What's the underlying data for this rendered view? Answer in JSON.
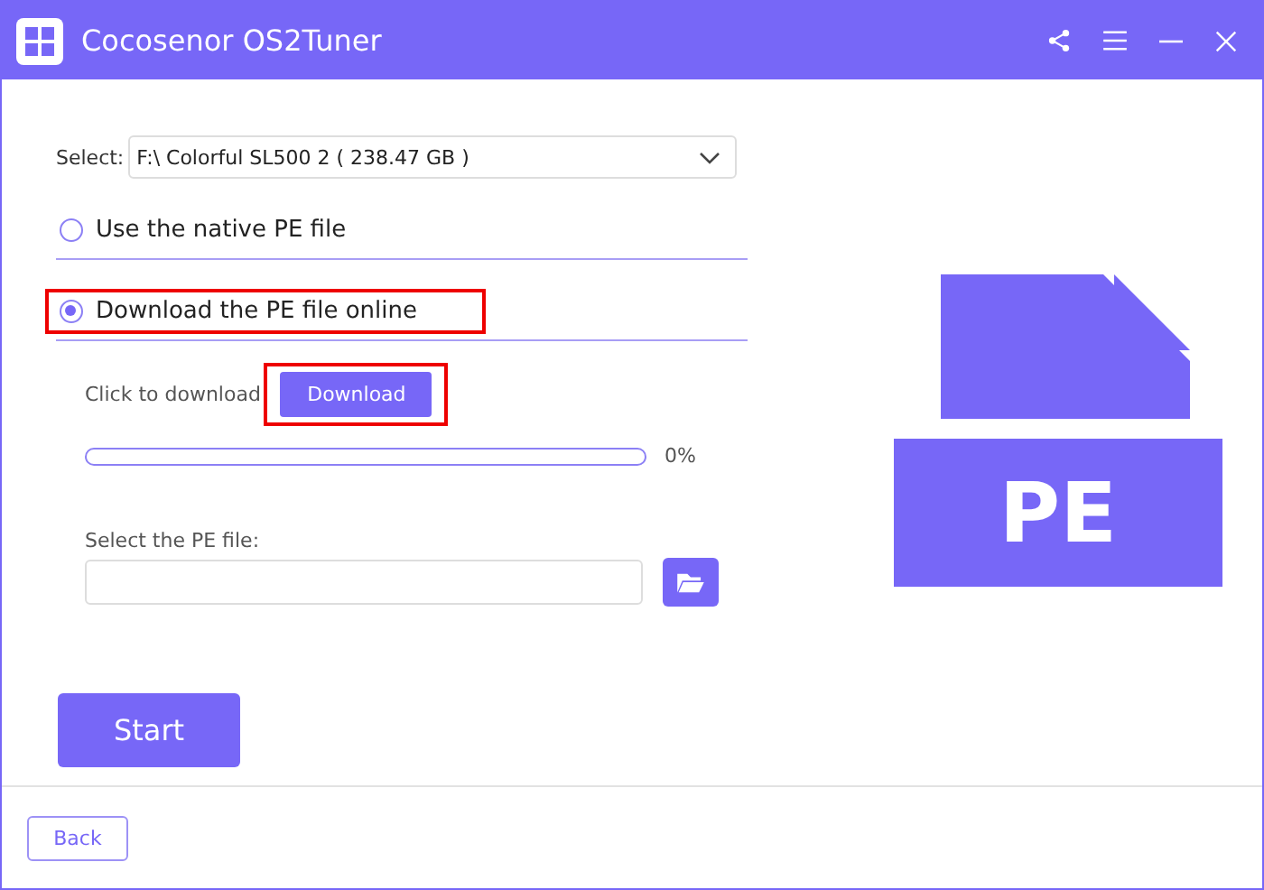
{
  "window": {
    "title": "Cocosenor OS2Tuner"
  },
  "select": {
    "label": "Select:",
    "value": "F:\\ Colorful SL500 2 ( 238.47 GB )"
  },
  "options": [
    {
      "label": "Use the native PE file",
      "selected": false,
      "highlighted": false
    },
    {
      "label": "Download the PE file online",
      "selected": true,
      "highlighted": true
    }
  ],
  "download": {
    "label": "Click to download",
    "button": "Download",
    "highlighted": true,
    "level": 0,
    "reading": "0%"
  },
  "pe_file": {
    "label": "Select the PE file:"
  },
  "pe_badge": "PE",
  "start_button": "Start",
  "back_button": "Back"
}
